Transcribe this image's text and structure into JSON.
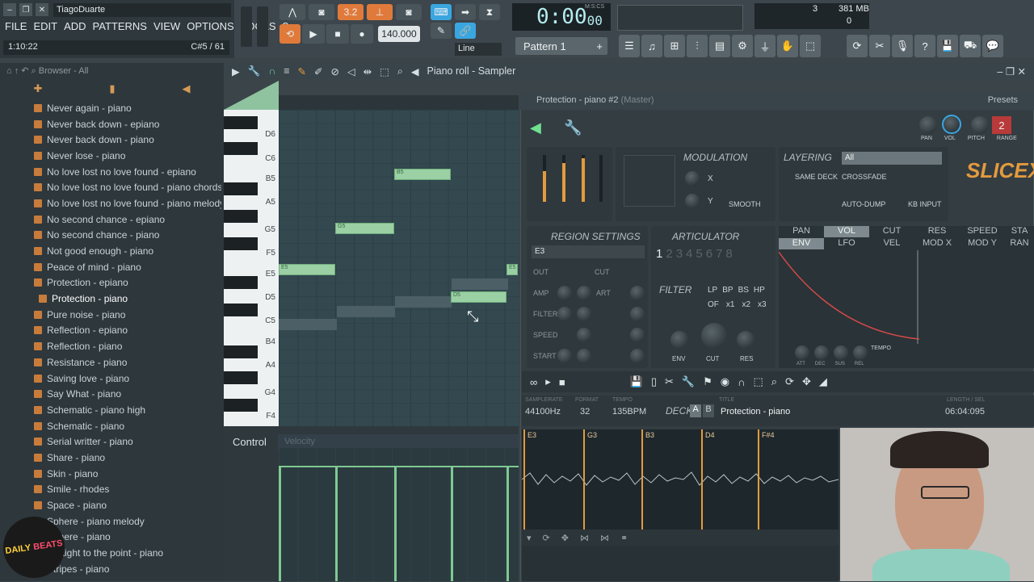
{
  "window": {
    "user": "TiagoDuarte"
  },
  "menu": [
    "FILE",
    "EDIT",
    "ADD",
    "PATTERNS",
    "VIEW",
    "OPTIONS",
    "TOOLS",
    "?"
  ],
  "hint_bar": {
    "time": "1:10:22",
    "note": "C#5 / 61"
  },
  "transport": {
    "tempo": "140.000",
    "time_display": "0:00",
    "time_sub": "00",
    "mcs": "M:S:CS",
    "snap": "Line"
  },
  "pattern": {
    "label": "Pattern 1"
  },
  "cpu": {
    "value": "3",
    "memory": "381 MB",
    "poly": "0"
  },
  "browser": {
    "title": "Browser - All",
    "items": [
      "Never again - piano",
      "Never back down - epiano",
      "Never back down - piano",
      "Never lose - piano",
      "No love lost no love found - epiano",
      "No love lost no love found - piano chords",
      "No love lost no love found - piano melody",
      "No second chance - epiano",
      "No second chance - piano",
      "Not good enough - piano",
      "Peace of mind - piano",
      "Protection - epiano",
      "Protection - piano",
      "Pure noise - piano",
      "Reflection - epiano",
      "Reflection - piano",
      "Resistance - piano",
      "Saving love - piano",
      "Say What - piano",
      "Schematic - piano high",
      "Schematic - piano",
      "Serial writter - piano",
      "Share - piano",
      "Skin - piano",
      "Smile - rhodes",
      "Space - piano",
      "Sphere - piano melody",
      "Sphere - piano",
      "Straight to the point - piano",
      "Stripes - piano"
    ],
    "selected_index": 12
  },
  "piano_roll": {
    "title": "Piano roll - Sampler",
    "key_labels": [
      "D6",
      "C6",
      "B5",
      "A5",
      "G5",
      "F5",
      "E5",
      "D5",
      "C5",
      "B4",
      "A4",
      "G4",
      "F4"
    ],
    "notes": [
      {
        "label": "B5"
      },
      {
        "label": "G5"
      },
      {
        "label": "E5"
      },
      {
        "label": "E5"
      },
      {
        "label": "D5"
      }
    ],
    "control_label": "Control",
    "velocity_label": "Velocity"
  },
  "plugin": {
    "title": "Protection - piano #2",
    "title_suffix": "(Master)",
    "presets": "Presets",
    "knob_labels": [
      "PAN",
      "VOL",
      "PITCH",
      "RANGE"
    ],
    "pitch_range": "2",
    "modulation": "MODULATION",
    "mod_x": "X",
    "mod_y": "Y",
    "smooth": "SMOOTH",
    "layering": "LAYERING",
    "layer_select": "All",
    "same_deck": "SAME DECK",
    "crossfade": "CROSSFADE",
    "auto_dump": "AUTO-DUMP",
    "kb_input": "KB INPUT",
    "logo": "SLICEX",
    "region_settings": "REGION SETTINGS",
    "region_value": "E3",
    "articulator": "ARTICULATOR",
    "art_numbers": [
      "1",
      "2",
      "3",
      "4",
      "5",
      "6",
      "7",
      "8"
    ],
    "rows": [
      "OUT",
      "AMP",
      "FILTER",
      "SPEED",
      "START"
    ],
    "art": "ART",
    "cut": "CUT",
    "filter": "FILTER",
    "filter_types": [
      "LP",
      "BP",
      "BS",
      "HP"
    ],
    "filter_mults": [
      "OF",
      "x1",
      "x2",
      "x3"
    ],
    "filter_knobs": [
      "ENV",
      "CUT",
      "RES"
    ],
    "tabs_row1": [
      "PAN",
      "VOL",
      "CUT",
      "RES",
      "SPEED",
      "STA"
    ],
    "tabs_row2": [
      "ENV",
      "LFO",
      "VEL",
      "MOD X",
      "MOD Y",
      "RAN"
    ],
    "env_knobs": [
      "ATT",
      "DEC",
      "SUS",
      "REL"
    ],
    "tempo": "TEMPO",
    "samplerate_label": "SAMPLERATE",
    "format_label": "FORMAT",
    "tempo_label": "TEMPO",
    "samplerate": "44100Hz",
    "format": "32",
    "bpm": "135BPM",
    "deck": "DECK",
    "deck_a": "A",
    "deck_b": "B",
    "title_label": "TITLE",
    "sample_title": "Protection - piano",
    "length_label": "LENGTH / SEL",
    "length": "06:04:095",
    "markers": [
      "E3",
      "G3",
      "B3",
      "D4",
      "F#4"
    ]
  },
  "colors": {
    "accent_orange": "#e39a3e",
    "note_green": "#9ad0a3",
    "active_blue": "#3aa6e0"
  }
}
